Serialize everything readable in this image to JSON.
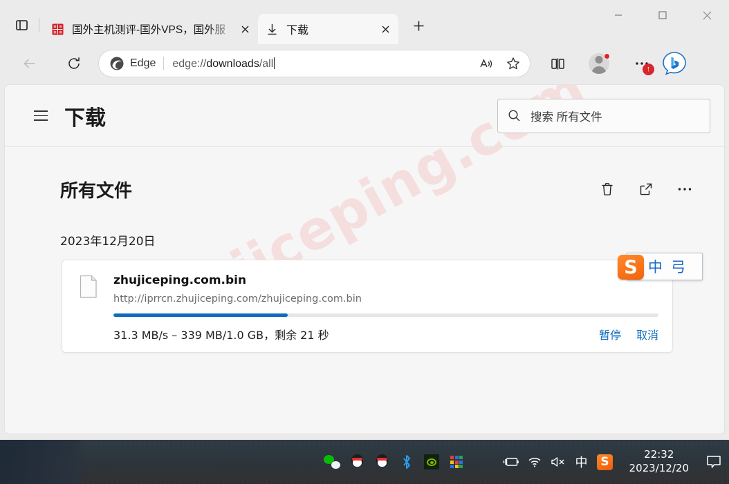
{
  "window": {
    "minimize_label": "–",
    "maximize_label": "□",
    "close_label": "✕"
  },
  "tabstrip": {
    "tab_actions_tooltip": "标签页操作菜单",
    "new_tab_label": "+",
    "tabs": [
      {
        "title": "国外主机测评-国外VPS，国外服",
        "favicon": "red-seal-favicon",
        "active": false,
        "close_label": "✕"
      },
      {
        "title": "下载",
        "favicon": "download-arrow-icon",
        "active": true,
        "close_label": "✕"
      }
    ]
  },
  "toolbar": {
    "back_icon": "back-arrow-icon",
    "refresh_icon": "refresh-icon",
    "omnibox": {
      "brand": "Edge",
      "url_prefix": "edge://",
      "url_main": "downloads",
      "url_suffix": "/all",
      "read_aloud_icon": "read-aloud-icon",
      "favorite_icon": "star-icon"
    },
    "split_screen_icon": "split-screen-icon",
    "profile_icon": "profile-avatar",
    "settings_more_icon": "more-options-icon",
    "update_badge": "↑",
    "copilot_icon": "bing-copilot-icon"
  },
  "downloads_page": {
    "menu_icon": "hamburger-menu-icon",
    "title": "下载",
    "search": {
      "icon": "search-icon",
      "placeholder": "搜索 所有文件"
    },
    "section": {
      "title": "所有文件",
      "actions": [
        {
          "name": "delete-all",
          "icon": "trash-icon"
        },
        {
          "name": "open-downloads-folder",
          "icon": "open-external-icon"
        },
        {
          "name": "more-actions",
          "icon": "ellipsis-icon"
        }
      ]
    },
    "date_group": "2023年12月20日",
    "item": {
      "file_icon": "file-document-icon",
      "filename": "zhujiceping.com.bin",
      "url": "http://iprrcn.zhujiceping.com/zhujiceping.com.bin",
      "progress_percent": 32,
      "status": "31.3 MB/s – 339 MB/1.0 GB，剩余 21 秒",
      "pause_label": "暂停",
      "cancel_label": "取消"
    },
    "watermark": "zhujiceping.com"
  },
  "ime_float": {
    "logo": "S",
    "mode": "中",
    "keyboard": "弓"
  },
  "taskbar": {
    "apps": [
      {
        "name": "wechat",
        "label": "微信"
      },
      {
        "name": "qq-1",
        "label": "QQ"
      },
      {
        "name": "qq-2",
        "label": "QQ"
      },
      {
        "name": "bluetooth",
        "label": "✶"
      },
      {
        "name": "nvidia",
        "label": "NVIDIA"
      },
      {
        "name": "color-grid",
        "label": ""
      }
    ],
    "tray": [
      {
        "name": "battery-charging",
        "label": "🔌"
      },
      {
        "name": "wifi",
        "label": "◠"
      },
      {
        "name": "volume-muted",
        "label": "🔇"
      },
      {
        "name": "ime-chinese",
        "label": "中"
      },
      {
        "name": "sogou-input",
        "label": "S"
      }
    ],
    "clock": {
      "time": "22:32",
      "date": "2023/12/20"
    },
    "notification_icon": "notification-bubble-icon"
  },
  "colors": {
    "accent_blue": "#0f6cbd",
    "badge_red": "#d8262c",
    "sogou_orange": "#f4630c",
    "watermark_pink": "#f3aeae"
  }
}
